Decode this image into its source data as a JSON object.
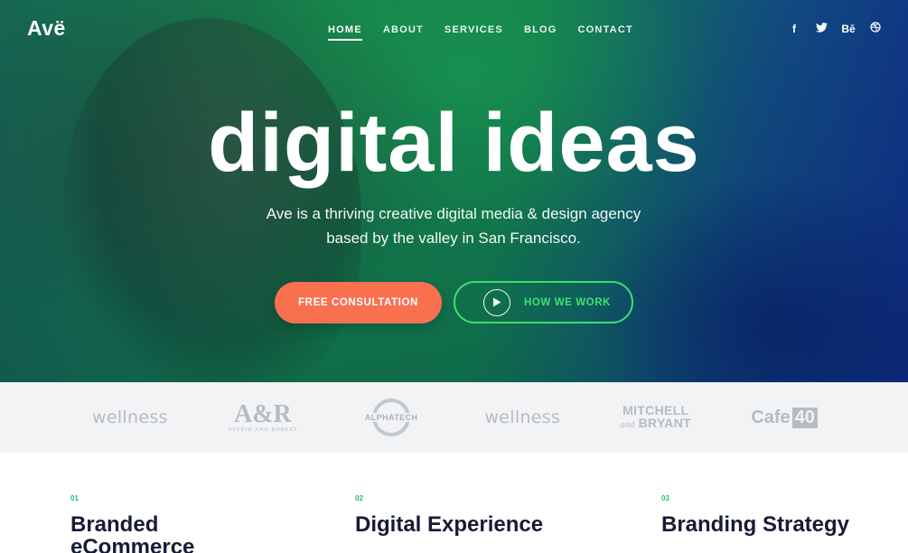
{
  "brand": {
    "logo": "Avë"
  },
  "nav": {
    "items": [
      {
        "label": "HOME",
        "active": true
      },
      {
        "label": "ABOUT"
      },
      {
        "label": "SERVICES"
      },
      {
        "label": "BLOG"
      },
      {
        "label": "CONTACT"
      }
    ]
  },
  "social": {
    "icons": [
      {
        "name": "facebook-icon",
        "glyph": "f"
      },
      {
        "name": "twitter-icon",
        "glyph": "🐦"
      },
      {
        "name": "behance-icon",
        "glyph": "Bē"
      },
      {
        "name": "dribbble-icon",
        "glyph": "◎"
      }
    ]
  },
  "hero": {
    "headline": "digital ideas",
    "subtitle_line1": "Ave is a thriving creative digital media & design agency",
    "subtitle_line2": "based by the valley in San Francisco.",
    "primary_button": "FREE CONSULTATION",
    "secondary_button": "HOW WE WORK"
  },
  "clients": {
    "logo1": "wellness",
    "logo2": "A&R",
    "logo2_sub": "ASTRID AND ROBERT",
    "logo3": "ALPHATECH",
    "logo4": "wellness",
    "logo5_line1": "MITCHELL",
    "logo5_line2_italic": "and",
    "logo5_line2": "BRYANT",
    "logo6_word": "Cafe",
    "logo6_num": "40"
  },
  "services": [
    {
      "num": "01",
      "title": "Branded eCommerce"
    },
    {
      "num": "02",
      "title": "Digital Experience"
    },
    {
      "num": "03",
      "title": "Branding Strategy"
    }
  ],
  "colors": {
    "accent_orange": "#f9704f",
    "accent_green": "#3fdc6e",
    "heading_navy": "#181b35"
  }
}
